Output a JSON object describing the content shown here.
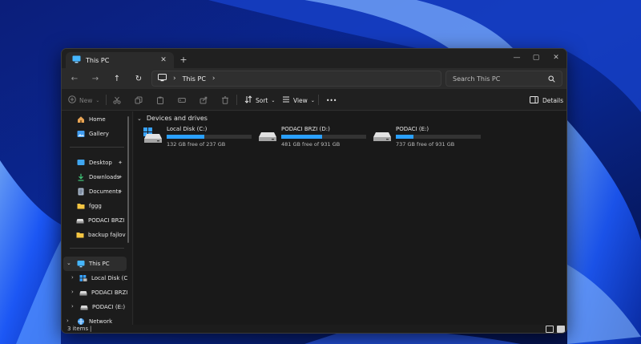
{
  "window": {
    "tab_title": "This PC",
    "close_glyph": "✕",
    "new_tab_glyph": "+",
    "controls": {
      "minimize": "—",
      "maximize": "▢",
      "close": "✕"
    }
  },
  "navigation": {
    "back": "←",
    "forward": "→",
    "up": "↑",
    "refresh": "↻",
    "breadcrumb": [
      "This PC"
    ],
    "search_placeholder": "Search This PC"
  },
  "toolbar": {
    "new_label": "New",
    "sort_label": "Sort",
    "view_label": "View",
    "more_label": "•••",
    "details_label": "Details",
    "icons": [
      "cut-icon",
      "copy-icon",
      "paste-icon",
      "rename-icon",
      "share-icon",
      "delete-icon"
    ]
  },
  "sidebar": {
    "quick": [
      {
        "label": "Home",
        "icon": "home-icon"
      },
      {
        "label": "Gallery",
        "icon": "gallery-icon"
      }
    ],
    "pinned": [
      {
        "label": "Desktop",
        "icon": "desktop-icon",
        "pinned": true
      },
      {
        "label": "Downloads",
        "icon": "downloads-icon",
        "pinned": true
      },
      {
        "label": "Documents",
        "icon": "documents-icon",
        "pinned": true
      },
      {
        "label": "fggg",
        "icon": "folder-icon",
        "pinned": false
      },
      {
        "label": "PODACI BRZI (D",
        "icon": "drive-icon",
        "pinned": false
      },
      {
        "label": "backup fajlovi s",
        "icon": "folder-icon",
        "pinned": false
      }
    ],
    "this_pc": {
      "label": "This PC",
      "icon": "this-pc-icon"
    },
    "drives": [
      {
        "label": "Local Disk (C:)",
        "icon": "windows-drive-icon"
      },
      {
        "label": "PODACI BRZI (",
        "icon": "drive-icon"
      },
      {
        "label": "PODACI (E:)",
        "icon": "drive-icon"
      }
    ],
    "network": {
      "label": "Network",
      "icon": "network-icon"
    },
    "pin_glyph": "📌"
  },
  "content": {
    "group_title": "Devices and drives",
    "drives": [
      {
        "name": "Local Disk (C:)",
        "free_text": "132 GB free of 237 GB",
        "used_fraction": 0.443,
        "icon": "windows-drive-icon"
      },
      {
        "name": "PODACI BRZI (D:)",
        "free_text": "481 GB free of 931 GB",
        "used_fraction": 0.483,
        "icon": "drive-icon"
      },
      {
        "name": "PODACI (E:)",
        "free_text": "737 GB free of 931 GB",
        "used_fraction": 0.208,
        "icon": "drive-icon"
      }
    ]
  },
  "status": {
    "items_text": "3 items",
    "caret": "|"
  },
  "colors": {
    "accent": "#2aa0ff",
    "window_bg": "#1c1c1c",
    "wallpaper": "#0a1a66"
  }
}
